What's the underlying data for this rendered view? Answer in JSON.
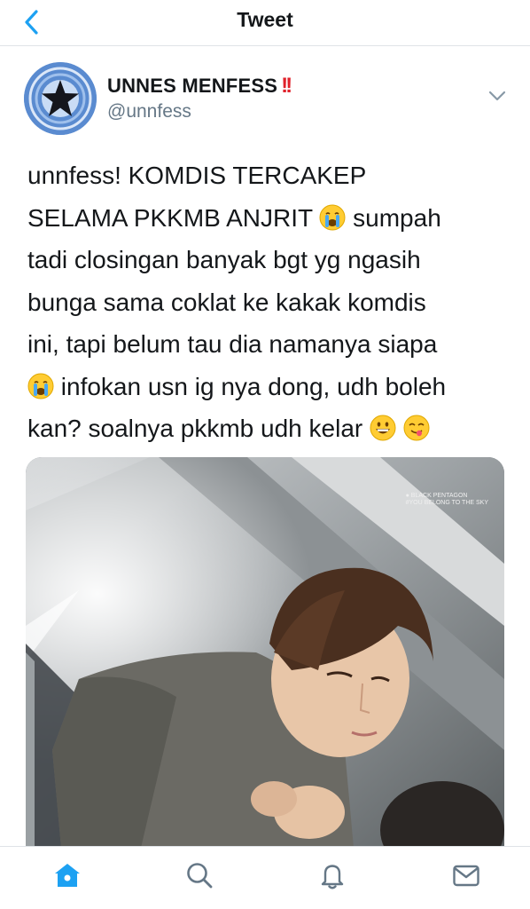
{
  "nav": {
    "title": "Tweet",
    "back_icon": "chevron-left-icon"
  },
  "account": {
    "name": "UNNES MENFESS",
    "name_emoji": "‼️",
    "handle": "@unnfess",
    "avatar_icon": "star-logo-icon"
  },
  "tweet": {
    "lines": [
      {
        "text": "unnfess! KOMDIS TERCAKEP",
        "emoji_after": ""
      },
      {
        "text": "SELAMA PKKMB ANJRIT ",
        "emoji_after": "loudly-crying-face",
        "text_after": " sumpah"
      },
      {
        "text": "tadi closingan banyak bgt yg ngasih",
        "emoji_after": ""
      },
      {
        "text": "bunga sama coklat ke kakak komdis",
        "emoji_after": ""
      },
      {
        "text": "ini, tapi belum tau dia namanya siapa",
        "emoji_after": ""
      },
      {
        "emoji_before": "loudly-crying-face",
        "text": " infokan usn ig nya dong, udh boleh"
      },
      {
        "text": "kan? soalnya pkkmb udh kelar ",
        "emojis_after": [
          "grinning-face",
          "face-savoring-food"
        ]
      }
    ],
    "media": {
      "alt": "photo",
      "watermark_line1": "● BLACK PENTAGON",
      "watermark_line2": "#YOU BELONG TO THE SKY"
    }
  },
  "tabs": [
    {
      "name": "home",
      "icon": "home-icon",
      "active": true
    },
    {
      "name": "search",
      "icon": "search-icon",
      "active": false
    },
    {
      "name": "notifications",
      "icon": "bell-icon",
      "active": false
    },
    {
      "name": "messages",
      "icon": "mail-icon",
      "active": false
    }
  ],
  "colors": {
    "accent": "#1da1f2",
    "icon_gray": "#657786",
    "text": "#14171a"
  }
}
